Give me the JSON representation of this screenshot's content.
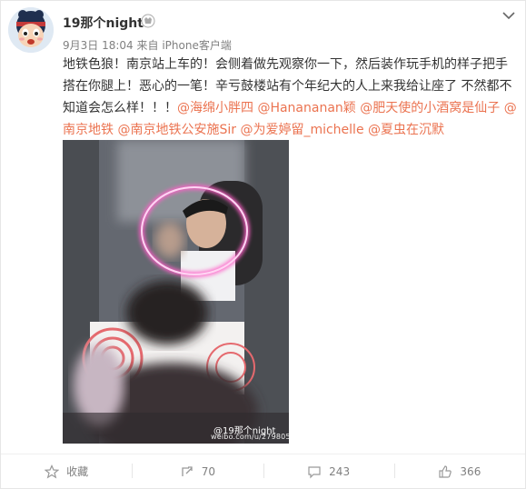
{
  "user": {
    "name": "19那个night",
    "avatar": "cartoon-avatar",
    "verified_icon": "vip-badge-icon"
  },
  "meta": {
    "time": "9月3日 18:04",
    "source": "来自 iPhone客户端"
  },
  "post": {
    "text": "地铁色狼！南京站上车的！会侧着做先观察你一下，然后装作玩手机的样子把手搭在你腿上！恶心的一笔！辛亏鼓楼站有个年纪大的人上来我给让座了 不然都不知道会怎么样！！！",
    "mentions": [
      "@海绵小胖四",
      "@Hanananan颖",
      "@肥天使的小酒窝是仙子",
      "@南京地铁",
      "@南京地铁公安施Sir",
      "@为爱婷留_michelle",
      "@夏虫在沉默"
    ]
  },
  "image": {
    "alt": "subway photo",
    "watermark_name": "@19那个night",
    "watermark_url": "weibo.com/u/2798056587"
  },
  "actions": {
    "favorite_label": "收藏",
    "forward_count": "70",
    "comment_count": "243",
    "like_count": "366"
  },
  "colors": {
    "mention": "#eb7350",
    "text": "#333333",
    "meta": "#808080",
    "circle": "#ff5fc8"
  }
}
